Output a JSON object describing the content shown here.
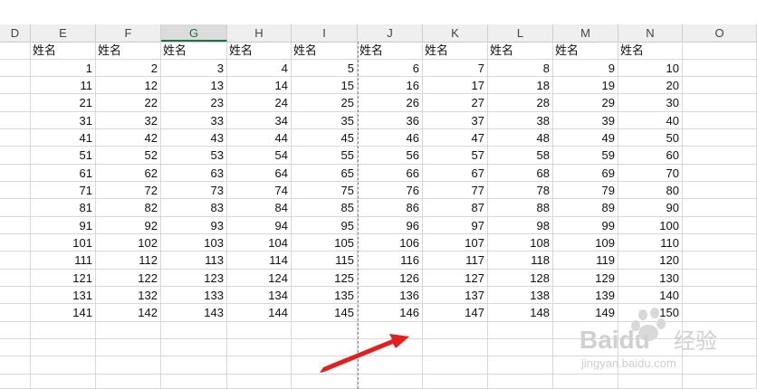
{
  "columns": [
    "D",
    "E",
    "F",
    "G",
    "H",
    "I",
    "J",
    "K",
    "L",
    "M",
    "N",
    "O"
  ],
  "selected_column": "G",
  "header_label": "姓名",
  "rows": [
    [
      1,
      2,
      3,
      4,
      5,
      6,
      7,
      8,
      9,
      10
    ],
    [
      11,
      12,
      13,
      14,
      15,
      16,
      17,
      18,
      19,
      20
    ],
    [
      21,
      22,
      23,
      24,
      25,
      26,
      27,
      28,
      29,
      30
    ],
    [
      31,
      32,
      33,
      34,
      35,
      36,
      37,
      38,
      39,
      40
    ],
    [
      41,
      42,
      43,
      44,
      45,
      46,
      47,
      48,
      49,
      50
    ],
    [
      51,
      52,
      53,
      54,
      55,
      56,
      57,
      58,
      59,
      60
    ],
    [
      61,
      62,
      63,
      64,
      65,
      66,
      67,
      68,
      69,
      70
    ],
    [
      71,
      72,
      73,
      74,
      75,
      76,
      77,
      78,
      79,
      80
    ],
    [
      81,
      82,
      83,
      84,
      85,
      86,
      87,
      88,
      89,
      90
    ],
    [
      91,
      92,
      93,
      94,
      95,
      96,
      97,
      98,
      99,
      100
    ],
    [
      101,
      102,
      103,
      104,
      105,
      106,
      107,
      108,
      109,
      110
    ],
    [
      111,
      112,
      113,
      114,
      115,
      116,
      117,
      118,
      119,
      120
    ],
    [
      121,
      122,
      123,
      124,
      125,
      126,
      127,
      128,
      129,
      130
    ],
    [
      131,
      132,
      133,
      134,
      135,
      136,
      137,
      138,
      139,
      140
    ],
    [
      141,
      142,
      143,
      144,
      145,
      146,
      147,
      148,
      149,
      150
    ]
  ],
  "watermark": {
    "brand": "Baidu",
    "suffix": "经验",
    "url": "jingyan.baidu.com"
  },
  "colors": {
    "selected_header": "#217346",
    "arrow": "#e0211f"
  }
}
